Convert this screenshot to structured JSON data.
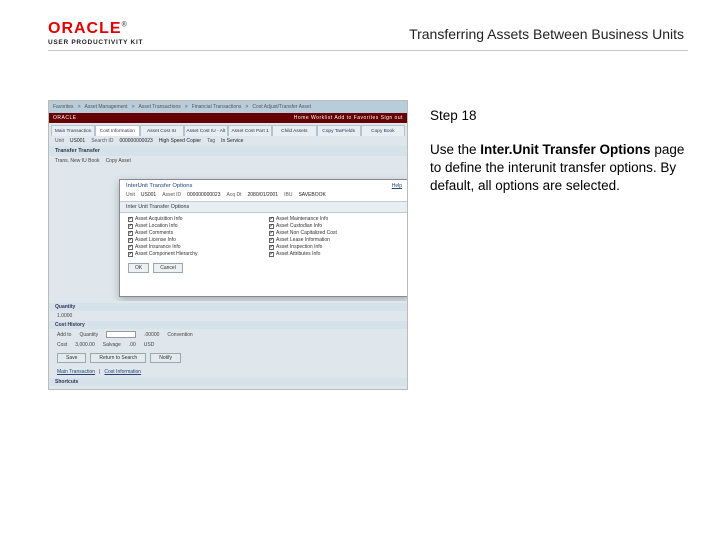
{
  "logo": {
    "brand": "ORACLE",
    "tm": "®",
    "subtitle": "USER PRODUCTIVITY KIT"
  },
  "doc_title": "Transferring Assets Between Business Units",
  "step_label": "Step 18",
  "instruction": {
    "prefix": "Use the ",
    "bold": "Inter.Unit Transfer Options",
    "suffix": " page to define the interunit transfer options. By default, all options are selected."
  },
  "screenshot": {
    "topbar_items": [
      "Favorites",
      "Asset Management",
      "Asset Transactions",
      "Financial Transactions",
      "Cost Adjust/Transfer Asset"
    ],
    "redbar": {
      "left": "ORACLE",
      "right_links": [
        "Home",
        "Worklist",
        "Add to Favorites",
        "Sign out"
      ]
    },
    "tabs": [
      "Main Transaction",
      "Cost Information",
      "Asset Cost IU",
      "Asset Cost IU - Alt",
      "Asset Cost Part 1",
      "Child Assets",
      "Copy TaxFields",
      "Copy Book"
    ],
    "header_row": {
      "unit_lbl": "Unit",
      "unit_val": "US001",
      "id_lbl": "Search ID",
      "id_val": "000000000023",
      "desc_lbl": "High Speed Copier",
      "tag_lbl": "Tag",
      "status_lbl": "In Service"
    },
    "section_transfer": "Transfer Transfer",
    "row2": {
      "trans_lbl": "Trans. New IU Book",
      "copy_asset": "Copy Asset"
    },
    "overlay": {
      "title": "InterUnit Transfer Options",
      "help": "Help",
      "fields": {
        "unit_lbl": "Unit",
        "unit_val": "US001",
        "assetid_lbl": "Asset ID",
        "assetid_val": "000000000023",
        "acqdt_lbl": "Acq Dt",
        "acqdt_val": "2080/01/2001",
        "iu_lbl": "IBU",
        "iu_val": "",
        "savebook_lbl": "SAVEBOOK"
      },
      "subhead": "Inter Unit Transfer Options",
      "checks_left": [
        "Asset Acquisition Info",
        "Asset Location Info",
        "Asset Comments",
        "Asset License Info",
        "Asset Insurance Info",
        "Asset Component Hierarchy"
      ],
      "checks_right": [
        "Asset Maintenance Info",
        "Asset Custodian Info",
        "Asset Non Capitalized Cost",
        "Asset Lease Information",
        "Asset Inspection Info",
        "Asset Attributes Info"
      ],
      "ok_btn": "OK",
      "cancel_btn": "Cancel"
    },
    "lower": {
      "quantity_hdr": "Quantity",
      "qty_lbl": "1.0000",
      "convention": "Convention",
      "costhist": "Cost History",
      "addto_lbl": "Add to",
      "qty2_lbl": "Quantity",
      "input_val": ".00000",
      "cost_lbl": "Cost",
      "cost_val": "3,000.00",
      "sal_lbl": "Salvage",
      "sal_val": ".00",
      "curr_val": "USD",
      "save_btn": "Save",
      "return_btn": "Return to Search",
      "notify_btn": "Notify",
      "footer_links": [
        "Main Transaction",
        "Cost Information"
      ],
      "shortcuts": "Shortcuts"
    }
  }
}
